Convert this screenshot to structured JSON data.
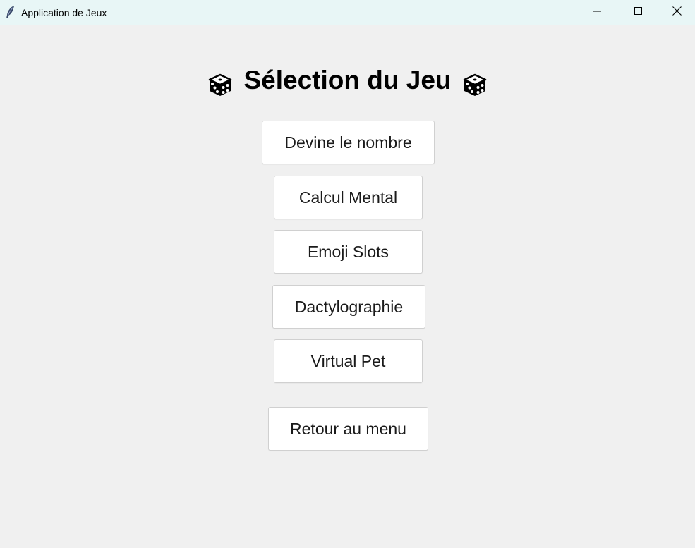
{
  "window": {
    "title": "Application de Jeux",
    "app_icon": "feather-icon",
    "controls": {
      "minimize": "minimize-icon",
      "maximize": "maximize-icon",
      "close": "close-icon"
    }
  },
  "header": {
    "title": "Sélection du Jeu",
    "icon": "dice-icon"
  },
  "games": [
    {
      "label": "Devine le nombre"
    },
    {
      "label": "Calcul Mental"
    },
    {
      "label": "Emoji Slots"
    },
    {
      "label": "Dactylographie"
    },
    {
      "label": "Virtual Pet"
    }
  ],
  "footer": {
    "back_label": "Retour au menu"
  },
  "colors": {
    "background": "#f0f0f0",
    "titlebar": "#e8f6f6",
    "button_bg": "#ffffff",
    "button_border": "#d0d0d0"
  }
}
